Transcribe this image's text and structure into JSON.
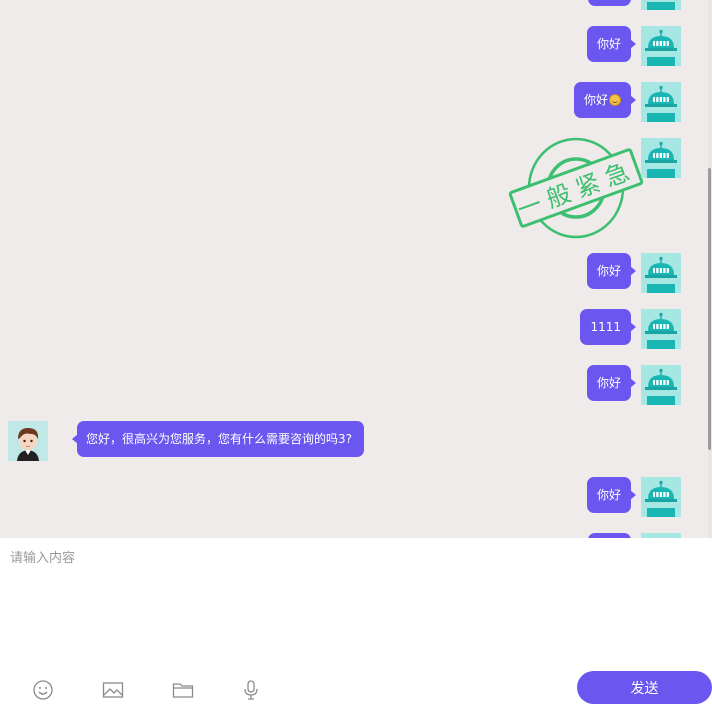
{
  "messages": [
    {
      "side": "right",
      "text": "",
      "has_emoji": false,
      "partial": true
    },
    {
      "side": "right",
      "text": "你好",
      "has_emoji": false
    },
    {
      "side": "right",
      "text": "你好",
      "has_emoji": true
    },
    {
      "side": "right",
      "text": "",
      "is_stamp": true
    },
    {
      "side": "right",
      "text": "你好",
      "has_emoji": false
    },
    {
      "side": "right",
      "text": "1111",
      "has_emoji": false
    },
    {
      "side": "right",
      "text": "你好",
      "has_emoji": false
    },
    {
      "side": "left",
      "text": "您好，很高兴为您服务，您有什么需要咨询的吗3?",
      "has_emoji": false
    },
    {
      "side": "right",
      "text": "你好",
      "has_emoji": false
    },
    {
      "side": "right",
      "text": "",
      "has_emoji": false,
      "partial": true
    }
  ],
  "stamp": {
    "text": "一般紧急",
    "color": "#3cbf6e"
  },
  "input": {
    "placeholder": "请输入内容",
    "value": ""
  },
  "toolbar": {
    "icons": [
      "emoji-icon",
      "image-icon",
      "folder-icon",
      "microphone-icon"
    ],
    "send_label": "发送"
  },
  "colors": {
    "accent": "#6b57f0",
    "chat_background": "#efebea",
    "robot_avatar": "#19b6b3"
  }
}
